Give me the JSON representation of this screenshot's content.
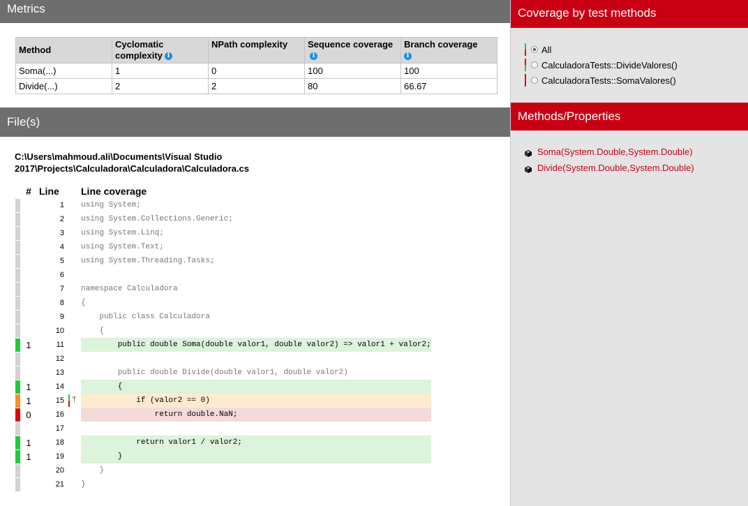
{
  "metrics": {
    "header": "Metrics",
    "columns": [
      "Method",
      "Cyclomatic complexity",
      "NPath complexity",
      "Sequence coverage",
      "Branch coverage"
    ],
    "rows": [
      {
        "method": "Soma(...)",
        "cyclomatic": "1",
        "npath": "0",
        "sequence": "100",
        "branch": "100"
      },
      {
        "method": "Divide(...)",
        "cyclomatic": "2",
        "npath": "2",
        "sequence": "80",
        "branch": "66.67"
      }
    ],
    "info_icon": "info-icon"
  },
  "files": {
    "header": "File(s)",
    "path": "C:\\Users\\mahmoud.ali\\Documents\\Visual Studio 2017\\Projects\\Calculadora\\Calculadora\\Calculadora.cs",
    "columns": {
      "hits": "#",
      "line": "Line",
      "coverage": "Line coverage"
    },
    "lines": [
      {
        "n": "1",
        "hits": "",
        "status": "none",
        "code": "using System;"
      },
      {
        "n": "2",
        "hits": "",
        "status": "none",
        "code": "using System.Collections.Generic;"
      },
      {
        "n": "3",
        "hits": "",
        "status": "none",
        "code": "using System.Linq;"
      },
      {
        "n": "4",
        "hits": "",
        "status": "none",
        "code": "using System.Text;"
      },
      {
        "n": "5",
        "hits": "",
        "status": "none",
        "code": "using System.Threading.Tasks;"
      },
      {
        "n": "6",
        "hits": "",
        "status": "none",
        "code": ""
      },
      {
        "n": "7",
        "hits": "",
        "status": "none",
        "code": "namespace Calculadora"
      },
      {
        "n": "8",
        "hits": "",
        "status": "none",
        "code": "{"
      },
      {
        "n": "9",
        "hits": "",
        "status": "none",
        "code": "    public class Calculadora"
      },
      {
        "n": "10",
        "hits": "",
        "status": "none",
        "code": "    {"
      },
      {
        "n": "11",
        "hits": "1",
        "status": "green",
        "code": "        public double Soma(double valor1, double valor2) => valor1 + valor2;"
      },
      {
        "n": "12",
        "hits": "",
        "status": "none",
        "code": ""
      },
      {
        "n": "13",
        "hits": "",
        "status": "none",
        "code": "        public double Divide(double valor1, double valor2)"
      },
      {
        "n": "14",
        "hits": "1",
        "status": "green",
        "code": "        {"
      },
      {
        "n": "15",
        "hits": "1",
        "status": "orange",
        "code": "            if (valor2 == 0)",
        "branch": true
      },
      {
        "n": "16",
        "hits": "0",
        "status": "red",
        "code": "                return double.NaN;"
      },
      {
        "n": "17",
        "hits": "",
        "status": "none",
        "code": ""
      },
      {
        "n": "18",
        "hits": "1",
        "status": "green",
        "code": "            return valor1 / valor2;"
      },
      {
        "n": "19",
        "hits": "1",
        "status": "green",
        "code": "        }"
      },
      {
        "n": "20",
        "hits": "",
        "status": "none",
        "code": "    }"
      },
      {
        "n": "21",
        "hits": "",
        "status": "none",
        "code": "}"
      }
    ]
  },
  "coverage_by_tests": {
    "header": "Coverage by test methods",
    "options": [
      {
        "label": "All",
        "selected": true,
        "bar": [
          "#22c93a",
          "#dd0a0a"
        ]
      },
      {
        "label": "CalculadoraTests::DivideValores()",
        "selected": false,
        "bar": [
          "#dd0a0a",
          "#22c93a"
        ]
      },
      {
        "label": "CalculadoraTests::SomaValores()",
        "selected": false,
        "bar": [
          "#dd0a0a",
          "#dd0a0a"
        ]
      }
    ]
  },
  "methods_properties": {
    "header": "Methods/Properties",
    "items": [
      "Soma(System.Double,System.Double)",
      "Divide(System.Double,System.Double)"
    ],
    "icon": "cube-icon"
  },
  "colors": {
    "accent": "#c90014",
    "section_header": "#6e6e6e",
    "covered": "#22c93a",
    "partial": "#f29322",
    "uncovered": "#dd0a0a"
  }
}
